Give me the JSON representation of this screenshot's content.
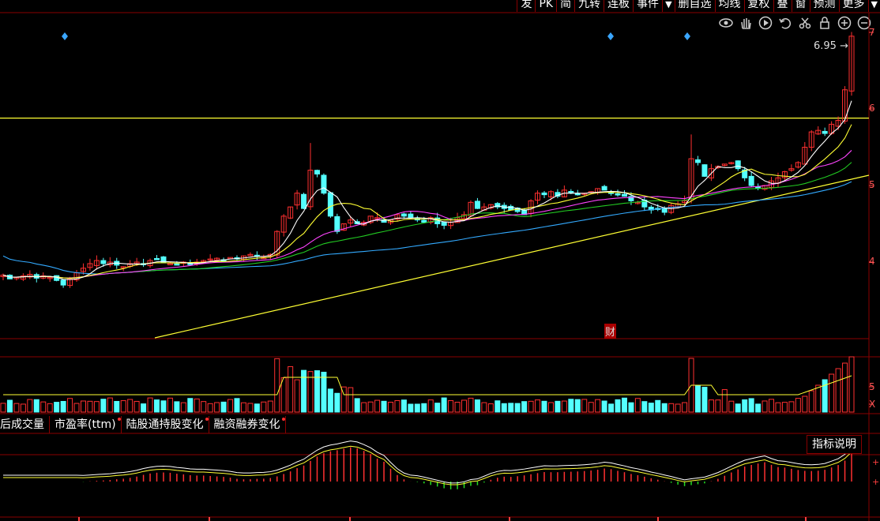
{
  "toolbar": {
    "buttons": [
      "发",
      "PK",
      "简",
      "九转",
      "连板",
      "事件",
      "▼",
      "删自选",
      "均线",
      "复权",
      "叠",
      "窗",
      "预测",
      "更多",
      "▼"
    ],
    "icons": [
      "eye-icon",
      "hand-icon",
      "play-icon",
      "undo-icon",
      "scissors-icon",
      "lock-icon",
      "zoom-in-icon",
      "zoom-out-icon"
    ]
  },
  "axis": {
    "price_ticks": [
      "7",
      "6",
      "5",
      "4"
    ],
    "volume_ticks": [
      "5",
      "X"
    ]
  },
  "price_tag": "6.95",
  "finance_tag": "财",
  "tabs": [
    {
      "label": "后成交量",
      "dot": false
    },
    {
      "label": "市盈率(ttm)",
      "dot": true
    },
    {
      "label": "陆股通持股变化",
      "dot": true
    },
    {
      "label": "融资融券变化",
      "dot": true
    }
  ],
  "explain_button": "指标说明",
  "colors": {
    "up": "#ff3030",
    "down": "#54ffff",
    "ma5": "#ffffff",
    "ma10": "#ffff33",
    "ma20": "#ff44ff",
    "ma30": "#22cc22",
    "ma60": "#33aaff",
    "hline": "#ffff33",
    "grid": "#8a0000"
  },
  "chart_data": {
    "type": "candlestick",
    "ylim": [
      3.3,
      7.0
    ],
    "resistance_level": 5.88,
    "close_prices": [
      3.83,
      3.78,
      3.8,
      3.82,
      3.84,
      3.79,
      3.82,
      3.8,
      3.76,
      3.7,
      3.78,
      3.86,
      3.92,
      3.98,
      4.02,
      3.98,
      4.0,
      3.96,
      3.94,
      3.98,
      4.0,
      3.98,
      4.02,
      4.04,
      4.0,
      3.98,
      3.96,
      4.0,
      3.98,
      4.0,
      4.02,
      4.04,
      4.05,
      4.03,
      4.06,
      4.05,
      4.08,
      4.1,
      4.08,
      4.06,
      4.1,
      4.4,
      4.6,
      4.72,
      4.9,
      4.7,
      5.2,
      5.15,
      4.9,
      4.6,
      4.4,
      4.5,
      4.55,
      4.5,
      4.52,
      4.6,
      4.58,
      4.52,
      4.55,
      4.62,
      4.6,
      4.58,
      4.55,
      4.52,
      4.58,
      4.5,
      4.48,
      4.52,
      4.58,
      4.62,
      4.78,
      4.7,
      4.72,
      4.75,
      4.72,
      4.7,
      4.68,
      4.66,
      4.62,
      4.8,
      4.9,
      4.88,
      4.92,
      4.86,
      4.94,
      4.9,
      4.88,
      4.9,
      4.92,
      4.96,
      4.94,
      4.9,
      4.88,
      4.86,
      4.8,
      4.78,
      4.72,
      4.68,
      4.7,
      4.65,
      4.74,
      4.76,
      4.8,
      5.35,
      5.3,
      5.12,
      5.22,
      5.25,
      5.28,
      5.3,
      5.22,
      5.1,
      5.0,
      4.98,
      5.0,
      5.06,
      5.1,
      5.18,
      5.22,
      5.3,
      5.5,
      5.7,
      5.72,
      5.68,
      5.8,
      5.85,
      6.25,
      6.95
    ]
  }
}
